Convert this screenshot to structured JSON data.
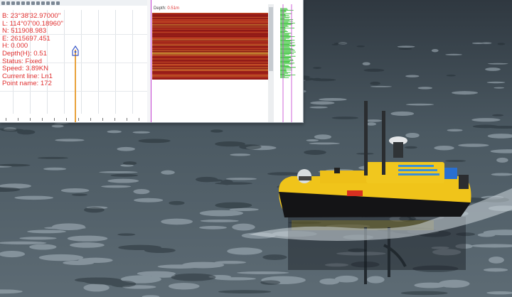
{
  "gps_info": {
    "B": "B: 23°38'32.97000''",
    "L": "L: 114°07'00.18960''",
    "N": "N: 511908.983",
    "E": "E: 2615697.451",
    "H": "H: 0.000",
    "depth": "Depth(H): 0.51",
    "status": "Status: Fixed",
    "speed": "Speed: 3.89KN",
    "current_line": "Current line: Ln1",
    "point_name": "Point name: 172"
  },
  "echo_header": {
    "label": "Depth:",
    "value": "0.51m"
  },
  "toolbar": {
    "icons": [
      "zoom-in-icon",
      "zoom-out-icon",
      "pan-icon",
      "fit-icon",
      "measure-icon",
      "line-icon",
      "point-icon",
      "layer-icon",
      "settings-icon",
      "record-icon",
      "stop-icon",
      "export-icon"
    ]
  },
  "colors": {
    "info_text": "#e03030",
    "echo_fill": "#a8231c",
    "echo_band": "#c9b43a",
    "waveform": "#22bb22",
    "depth_line": "#c43fd0"
  }
}
